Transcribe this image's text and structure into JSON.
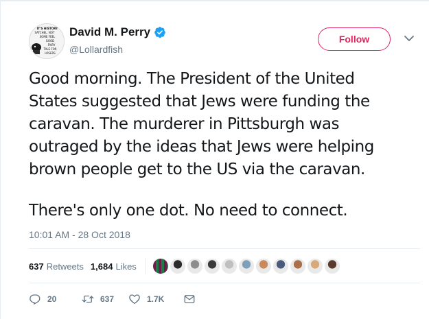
{
  "author": {
    "display_name": "David M. Perry",
    "handle": "@Lollardfish",
    "avatar_text": "IT'S HISTORY SATCHEL. NOT SOME FEEL GOOD FAIRY TALE FOR LOSERS",
    "verified": true
  },
  "follow_label": "Follow",
  "tweet": {
    "lines": [
      "Good morning. The President of the United",
      "States suggested that Jews were funding the",
      "caravan. The murderer in Pittsburgh was",
      "outraged by the ideas that Jews were helping",
      "brown people get to the US via the caravan."
    ],
    "closing_line": "There's only one dot. No need to connect."
  },
  "timestamp": "10:01 AM - 28 Oct 2018",
  "stats": {
    "retweets_count": "637",
    "retweets_label": "Retweets",
    "likes_count": "1,684",
    "likes_label": "Likes"
  },
  "likers": [
    {
      "name": "liker-1",
      "color": "#7a2a57"
    },
    {
      "name": "liker-2",
      "color": "#2b2b2b"
    },
    {
      "name": "liker-3",
      "color": "#8c8c8c"
    },
    {
      "name": "liker-4",
      "color": "#3a3a3a"
    },
    {
      "name": "liker-5",
      "color": "#bfbfbf"
    },
    {
      "name": "liker-6",
      "color": "#7f9fb8"
    },
    {
      "name": "liker-7",
      "color": "#c88a5b"
    },
    {
      "name": "liker-8",
      "color": "#4a5a7a"
    },
    {
      "name": "liker-9",
      "color": "#a86f4a"
    },
    {
      "name": "liker-10",
      "color": "#d8a97a"
    },
    {
      "name": "liker-11",
      "color": "#5c3b2e"
    }
  ],
  "actions": {
    "reply_count": "20",
    "retweet_count": "637",
    "like_count": "1.7K",
    "icons": [
      "reply-icon",
      "retweet-icon",
      "heart-icon",
      "direct-message-icon"
    ]
  },
  "colors": {
    "follow_accent": "#e0245e",
    "verified_blue": "#1da1f2",
    "secondary_text": "#657786"
  }
}
